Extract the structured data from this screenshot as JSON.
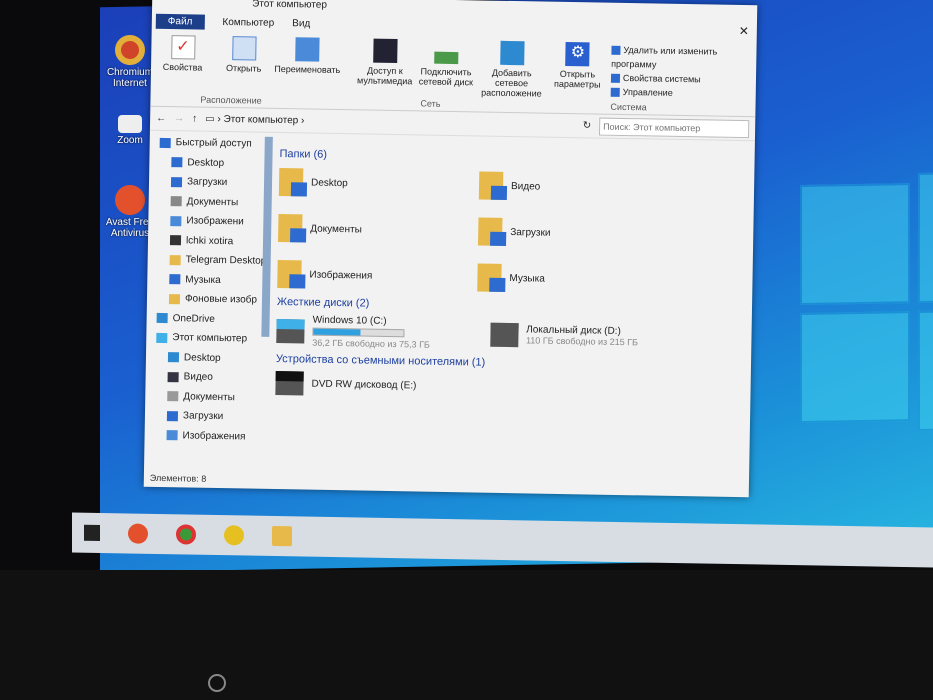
{
  "desktop": {
    "icons": [
      {
        "label": "Chromium Internet"
      },
      {
        "label": "Zoom"
      },
      {
        "label": "Avast Free Antivirus"
      }
    ]
  },
  "window": {
    "title": "Этот компьютер",
    "tabs": [
      {
        "label": "Файл"
      },
      {
        "label": "Компьютер"
      },
      {
        "label": "Вид"
      }
    ],
    "ribbon": {
      "location": {
        "label": "Расположение",
        "buttons": [
          {
            "label": "Свойства"
          },
          {
            "label": "Открыть"
          },
          {
            "label": "Переименовать"
          }
        ]
      },
      "network": {
        "label": "Сеть",
        "buttons": [
          {
            "label": "Доступ к мультимедиа"
          },
          {
            "label": "Подключить сетевой диск"
          },
          {
            "label": "Добавить сетевое расположение"
          }
        ]
      },
      "system": {
        "label": "Система",
        "open_settings": "Открыть параметры",
        "items": [
          {
            "label": "Удалить или изменить программу"
          },
          {
            "label": "Свойства системы"
          },
          {
            "label": "Управление"
          }
        ]
      }
    },
    "address": {
      "path": "Этот компьютер",
      "search_placeholder": "Поиск: Этот компьютер"
    },
    "nav": [
      {
        "label": "Быстрый доступ"
      },
      {
        "label": "Desktop"
      },
      {
        "label": "Загрузки"
      },
      {
        "label": "Документы"
      },
      {
        "label": "Изображени"
      },
      {
        "label": "lchki xotira"
      },
      {
        "label": "Telegram Desktop"
      },
      {
        "label": "Музыка"
      },
      {
        "label": "Фоновые изобр"
      },
      {
        "label": "OneDrive"
      },
      {
        "label": "Этот компьютер"
      },
      {
        "label": "Desktop"
      },
      {
        "label": "Видео"
      },
      {
        "label": "Документы"
      },
      {
        "label": "Загрузки"
      },
      {
        "label": "Изображения"
      }
    ],
    "folders_header": "Папки (6)",
    "folders": [
      {
        "label": "Desktop"
      },
      {
        "label": "Видео"
      },
      {
        "label": "Документы"
      },
      {
        "label": "Загрузки"
      },
      {
        "label": "Изображения"
      },
      {
        "label": "Музыка"
      }
    ],
    "drives_header": "Жесткие диски (2)",
    "drives": [
      {
        "label": "Windows 10 (C:)",
        "free": "36,2 ГБ свободно из 75,3 ГБ",
        "used_fraction": 0.52
      },
      {
        "label": "Локальный диск (D:)",
        "free": "110 ГБ свободно из 215 ГБ"
      }
    ],
    "removable_header": "Устройства со съемными носителями (1)",
    "removable": [
      {
        "label": "DVD RW дисковод (E:)"
      }
    ],
    "status": "Элементов: 8"
  }
}
